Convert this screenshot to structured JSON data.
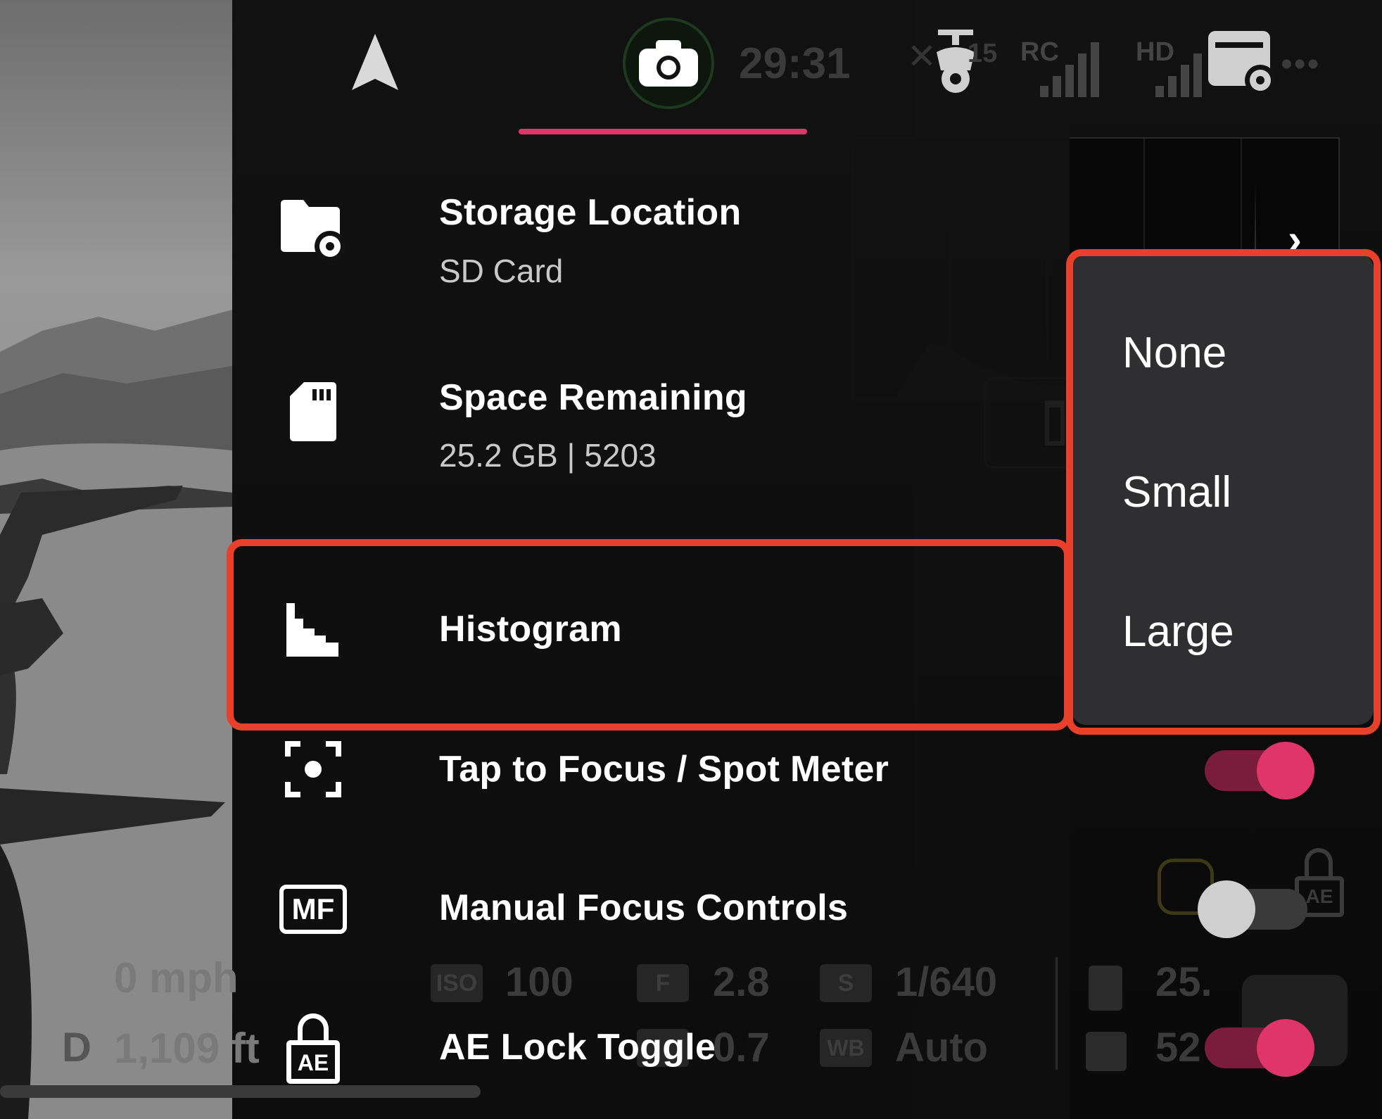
{
  "status_bar": {
    "timer": "29:31",
    "satellites": "15",
    "rc_label": "RC",
    "hd_label": "HD"
  },
  "settings": [
    {
      "title": "Storage Location",
      "subtitle": "SD Card"
    },
    {
      "title": "Space Remaining",
      "subtitle": "25.2 GB | 5203"
    },
    {
      "title": "Histogram"
    },
    {
      "title": "Tap to Focus / Spot Meter",
      "enabled": true
    },
    {
      "title": "Manual Focus Controls",
      "enabled": false
    },
    {
      "title": "AE Lock Toggle",
      "enabled": true
    }
  ],
  "histogram_menu": {
    "options": [
      "None",
      "Small",
      "Large"
    ]
  },
  "mf_icon_text": "MF",
  "ae_icon_text": "AE",
  "telemetry": {
    "speed": "0 mph",
    "distance_prefix": "D",
    "distance": "1,109 ft",
    "iso_label": "ISO",
    "iso": "100",
    "f_label": "F",
    "f": "2.8",
    "s_label": "S",
    "shutter": "1/640",
    "ev": "0.7",
    "wb_label": "WB",
    "wb": "Auto",
    "storage_a": "25.",
    "storage_b": "52"
  },
  "colors": {
    "accent": "#e0356b",
    "highlight": "#e8402a",
    "panel": "#121212",
    "dropdown": "#2f2f31"
  }
}
